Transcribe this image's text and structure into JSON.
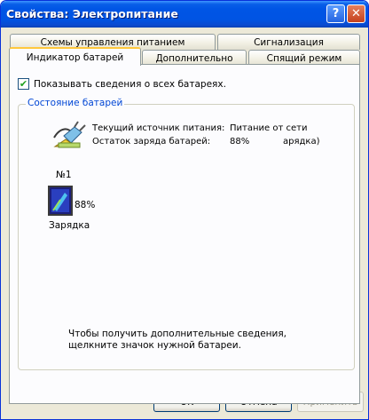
{
  "window": {
    "title": "Свойства: Электропитание",
    "help_label": "?",
    "close_label": "✕"
  },
  "tabs": {
    "row_back": [
      {
        "label": "Схемы управления питанием"
      },
      {
        "label": "Сигнализация"
      }
    ],
    "row_front": [
      {
        "label": "Индикатор батарей",
        "active": true
      },
      {
        "label": "Дополнительно"
      },
      {
        "label": "Спящий режим"
      }
    ]
  },
  "options": {
    "show_all_batteries_label": "Показывать сведения о всех батареях.",
    "show_all_batteries_checked": true,
    "check_mark": "✔"
  },
  "status_group": {
    "title": "Состояние батарей",
    "source_label": "Текущий источник питания:",
    "source_value": "Питание от сети",
    "charge_label": "Остаток заряда батарей:",
    "charge_value": "88%",
    "charge_extra": "арядка)"
  },
  "battery": {
    "number": "№1",
    "percent": "88%",
    "percent_value": 88,
    "state": "Зарядка"
  },
  "hint": {
    "line1": "Чтобы получить дополнительные сведения,",
    "line2": "щелкните значок нужной батареи."
  },
  "buttons": {
    "ok": "OK",
    "cancel": "Отмена",
    "apply": "Применить"
  },
  "colors": {
    "titlebar": "#0054e3",
    "group_title": "#0046d5",
    "active_tab_accent": "#ffc83c"
  }
}
